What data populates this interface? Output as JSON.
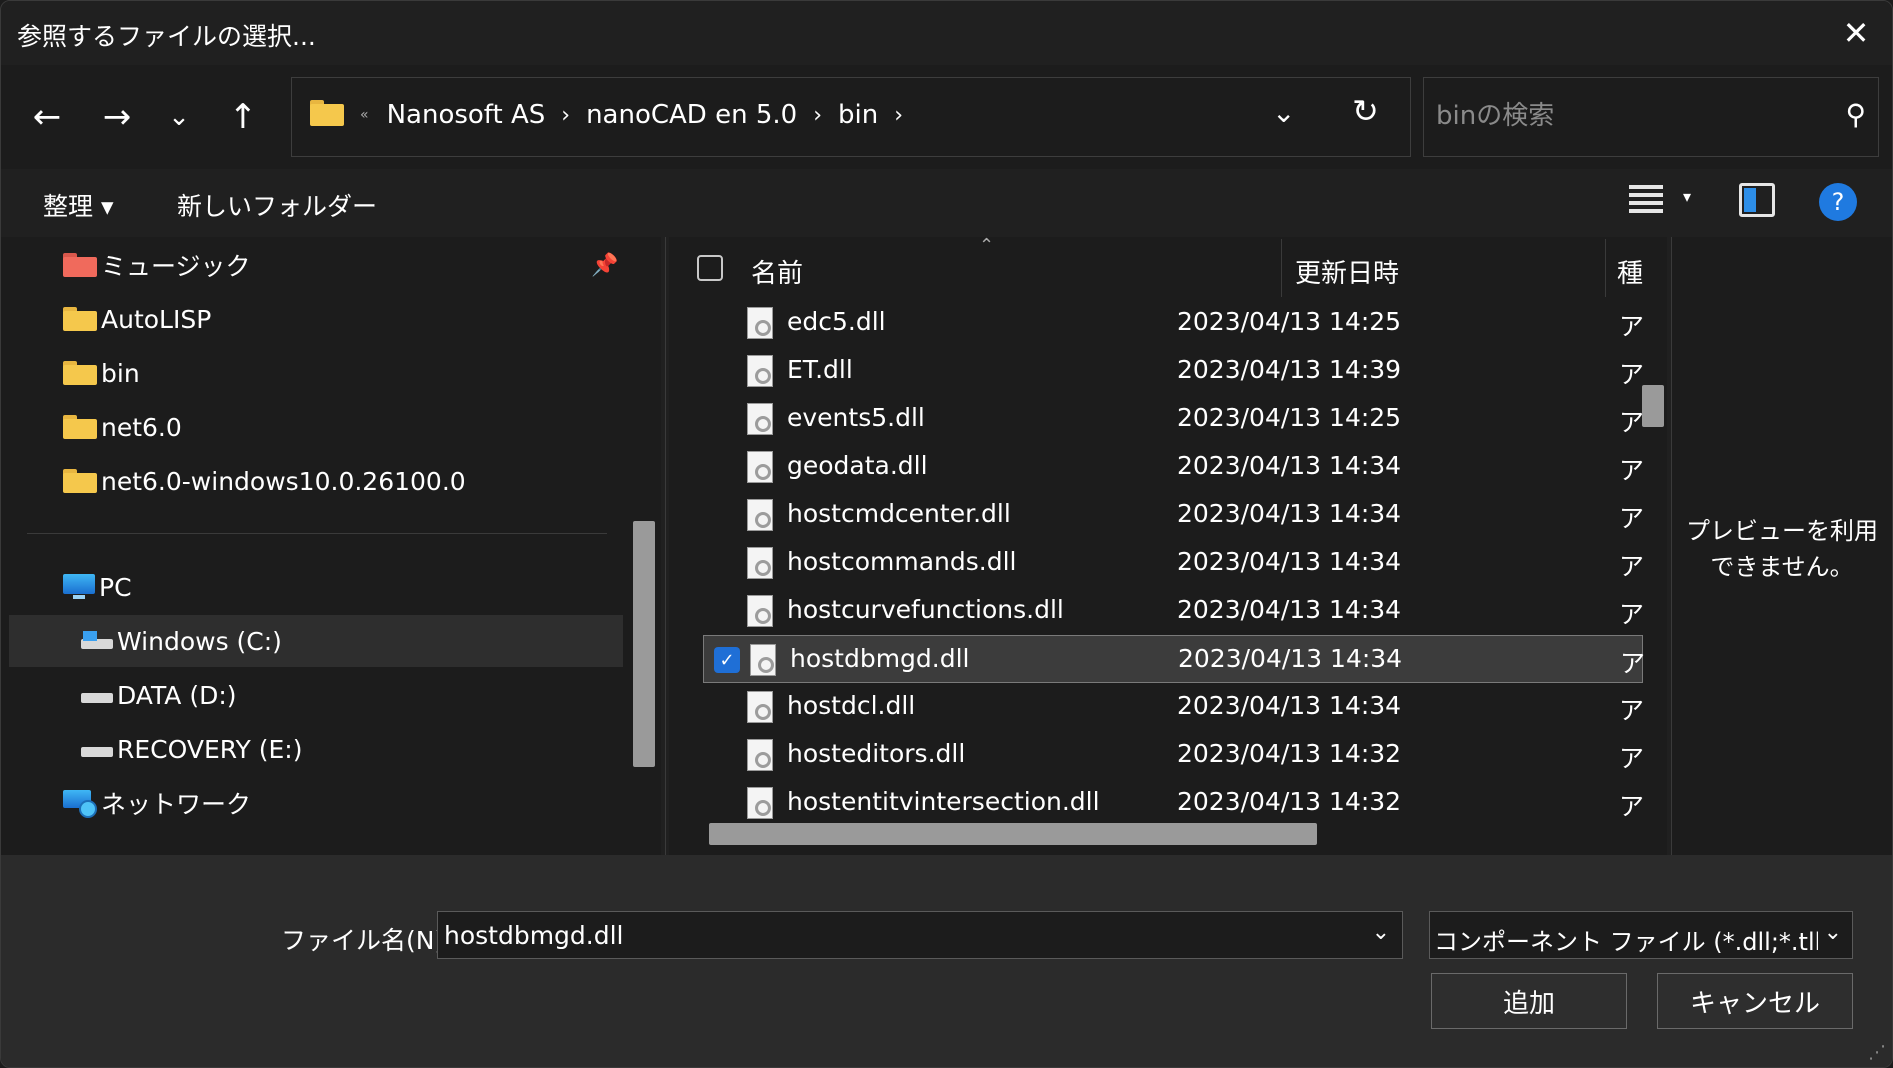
{
  "window": {
    "title": "参照するファイルの選択..."
  },
  "nav": {
    "back_icon": "arrow-left-icon",
    "forward_icon": "arrow-right-icon",
    "recent_icon": "chevron-down-icon",
    "up_icon": "arrow-up-icon"
  },
  "address": {
    "overflow": "«",
    "crumbs": [
      "Nanosoft AS",
      "nanoCAD en 5.0",
      "bin"
    ]
  },
  "search": {
    "placeholder": "binの検索"
  },
  "toolbar": {
    "organize": "整理 ▾",
    "new_folder": "新しいフォルダー"
  },
  "sidebar": {
    "quick": [
      {
        "label": "ミュージック",
        "icon": "music-folder-icon"
      },
      {
        "label": "AutoLISP",
        "icon": "folder-icon"
      },
      {
        "label": "bin",
        "icon": "folder-icon"
      },
      {
        "label": "net6.0",
        "icon": "folder-icon"
      },
      {
        "label": "net6.0-windows10.0.26100.0",
        "icon": "folder-icon"
      }
    ],
    "pc": "PC",
    "drives": [
      "Windows (C:)",
      "DATA (D:)",
      "RECOVERY (E:)"
    ],
    "network": "ネットワーク"
  },
  "columns": {
    "name": "名前",
    "date": "更新日時",
    "type": "種"
  },
  "files": [
    {
      "name": "edc5.dll",
      "date": "2023/04/13 14:25",
      "type": "ア"
    },
    {
      "name": "ET.dll",
      "date": "2023/04/13 14:39",
      "type": "ア"
    },
    {
      "name": "events5.dll",
      "date": "2023/04/13 14:25",
      "type": "ア"
    },
    {
      "name": "geodata.dll",
      "date": "2023/04/13 14:34",
      "type": "ア"
    },
    {
      "name": "hostcmdcenter.dll",
      "date": "2023/04/13 14:34",
      "type": "ア"
    },
    {
      "name": "hostcommands.dll",
      "date": "2023/04/13 14:34",
      "type": "ア"
    },
    {
      "name": "hostcurvefunctions.dll",
      "date": "2023/04/13 14:34",
      "type": "ア"
    },
    {
      "name": "hostdbmgd.dll",
      "date": "2023/04/13 14:34",
      "type": "ア",
      "selected": true
    },
    {
      "name": "hostdcl.dll",
      "date": "2023/04/13 14:34",
      "type": "ア"
    },
    {
      "name": "hosteditors.dll",
      "date": "2023/04/13 14:32",
      "type": "ア"
    },
    {
      "name": "hostentitvintersection.dll",
      "date": "2023/04/13 14:32",
      "type": "ア"
    }
  ],
  "preview": {
    "message": "プレビューを利用できません。"
  },
  "footer": {
    "filename_label": "ファイル名(N):",
    "filename_value": "hostdbmgd.dll",
    "filetype": "コンポーネント ファイル (*.dll;*.tlb;*.o",
    "add": "追加",
    "cancel": "キャンセル"
  },
  "colors": {
    "accent": "#1f6fd6",
    "folder": "#f5c84c",
    "background": "#202020"
  }
}
